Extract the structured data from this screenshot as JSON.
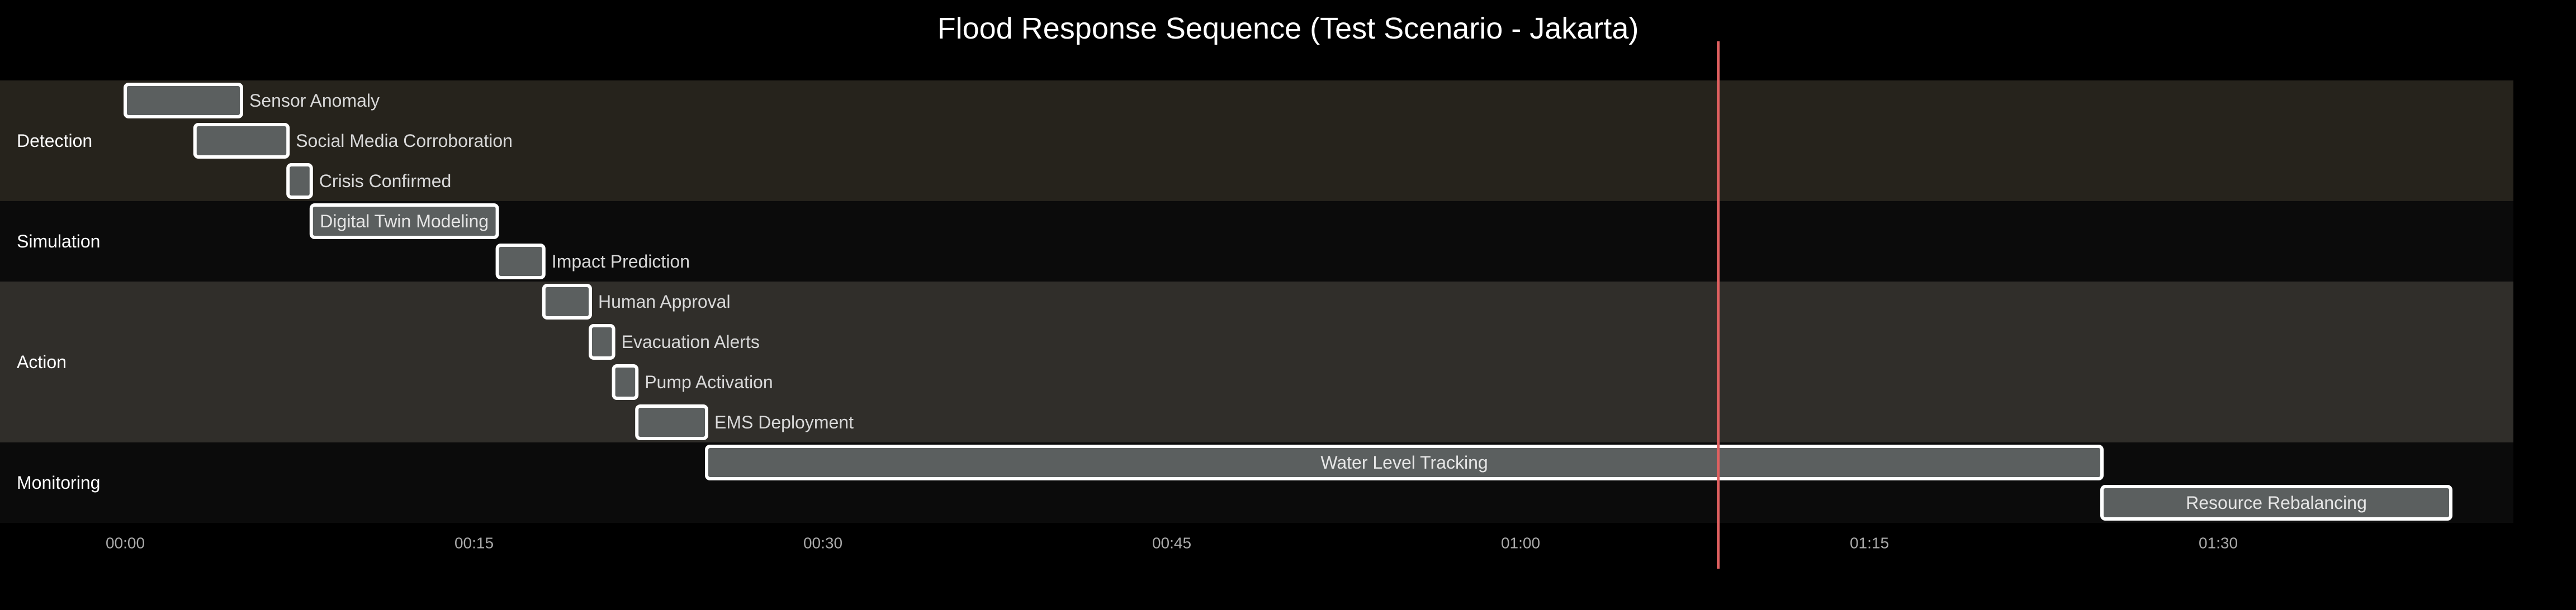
{
  "chart_data": {
    "type": "gantt",
    "title": "Flood Response Sequence (Test Scenario - Jakarta)",
    "x_unit": "minutes",
    "xlim": [
      0,
      103
    ],
    "x_ticks": [
      {
        "value": 0,
        "label": "00:00"
      },
      {
        "value": 15,
        "label": "00:15"
      },
      {
        "value": 30,
        "label": "00:30"
      },
      {
        "value": 45,
        "label": "00:45"
      },
      {
        "value": 60,
        "label": "01:00"
      },
      {
        "value": 75,
        "label": "01:15"
      },
      {
        "value": 90,
        "label": "01:30"
      }
    ],
    "current_time_marker": {
      "value": 68.5,
      "color": "#e06060"
    },
    "lanes": [
      {
        "name": "Detection",
        "color": "#26231c"
      },
      {
        "name": "Simulation",
        "color": "#0b0b0b"
      },
      {
        "name": "Action",
        "color": "#302e2a"
      },
      {
        "name": "Monitoring",
        "color": "#0b0b0b"
      }
    ],
    "tasks": [
      {
        "name": "Sensor Anomaly",
        "lane": "Detection",
        "start": 0,
        "end": 5,
        "label_inside": false
      },
      {
        "name": "Social Media Corroboration",
        "lane": "Detection",
        "start": 3,
        "end": 7,
        "label_inside": false
      },
      {
        "name": "Crisis Confirmed",
        "lane": "Detection",
        "start": 7,
        "end": 8,
        "label_inside": false
      },
      {
        "name": "Digital Twin Modeling",
        "lane": "Simulation",
        "start": 8,
        "end": 16,
        "label_inside": true
      },
      {
        "name": "Impact Prediction",
        "lane": "Simulation",
        "start": 16,
        "end": 18,
        "label_inside": false
      },
      {
        "name": "Human Approval",
        "lane": "Action",
        "start": 18,
        "end": 20,
        "label_inside": false
      },
      {
        "name": "Evacuation Alerts",
        "lane": "Action",
        "start": 20,
        "end": 21,
        "label_inside": false
      },
      {
        "name": "Pump Activation",
        "lane": "Action",
        "start": 21,
        "end": 22,
        "label_inside": false
      },
      {
        "name": "EMS Deployment",
        "lane": "Action",
        "start": 22,
        "end": 25,
        "label_inside": false
      },
      {
        "name": "Water Level Tracking",
        "lane": "Monitoring",
        "start": 25,
        "end": 85,
        "label_inside": true
      },
      {
        "name": "Resource Rebalancing",
        "lane": "Monitoring",
        "start": 85,
        "end": 100,
        "label_inside": true
      }
    ]
  }
}
